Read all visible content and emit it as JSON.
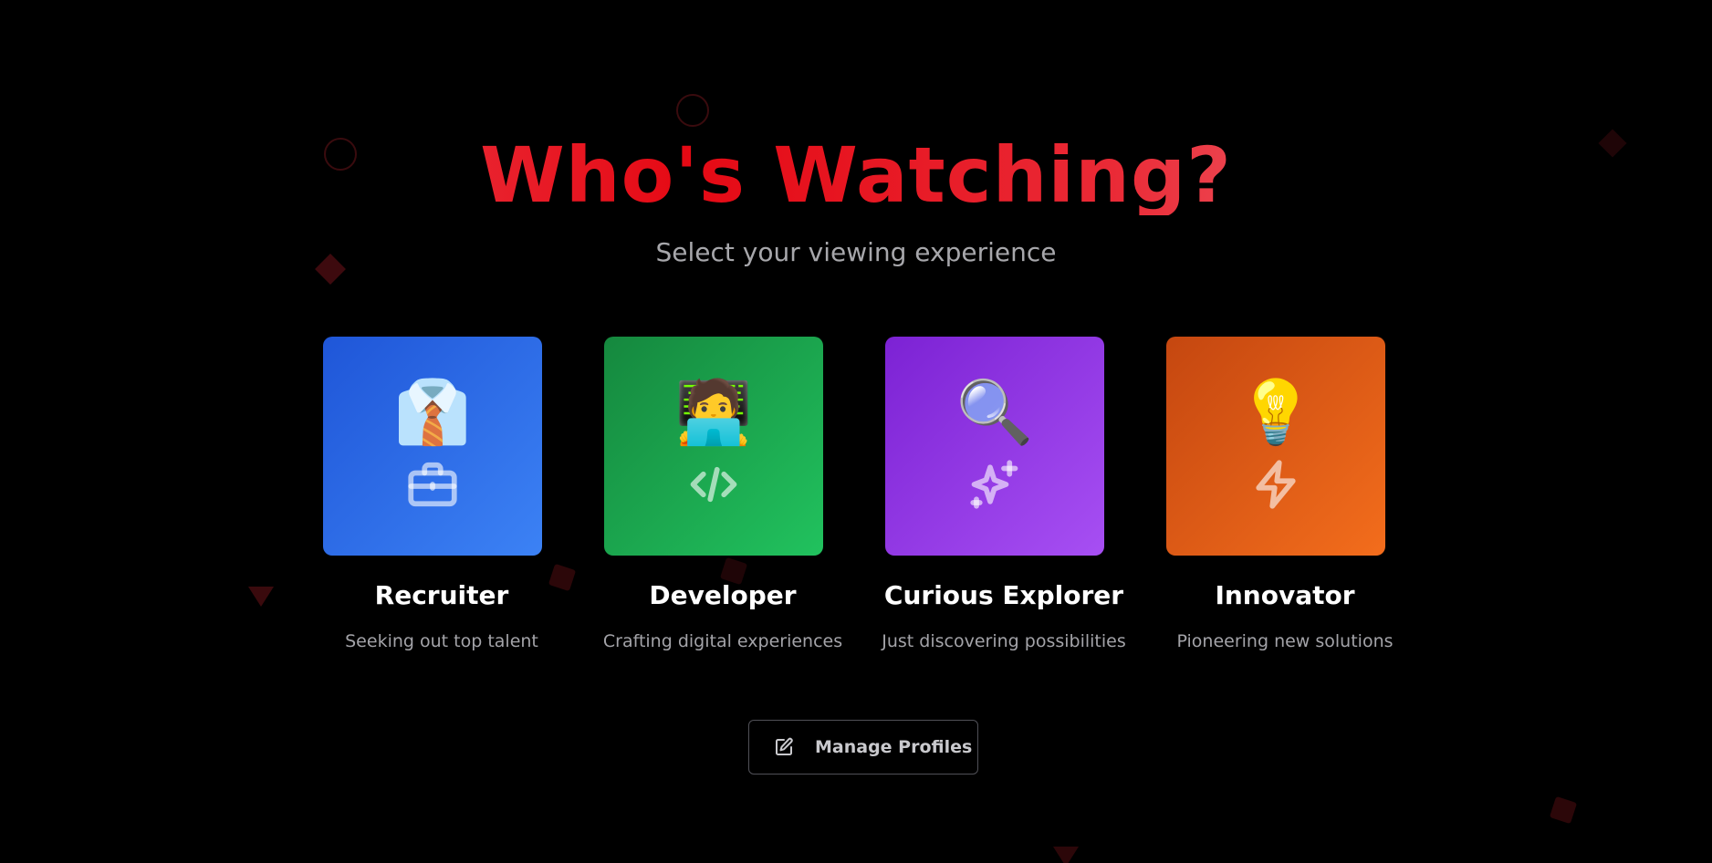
{
  "header": {
    "title": "Who's Watching?",
    "subtitle": "Select your viewing experience"
  },
  "profiles": [
    {
      "name": "Recruiter",
      "description": "Seeking out top talent",
      "emoji": "👔",
      "icon": "briefcase-icon",
      "color_from": "#1f56d8",
      "color_to": "#3c82f5"
    },
    {
      "name": "Developer",
      "description": "Crafting digital experiences",
      "emoji": "🧑‍💻",
      "icon": "code-icon",
      "color_from": "#15883e",
      "color_to": "#21c25e"
    },
    {
      "name": "Curious Explorer",
      "description": "Just discovering possibilities",
      "emoji": "🔍",
      "icon": "sparkles-icon",
      "color_from": "#7c22d4",
      "color_to": "#a74ff3"
    },
    {
      "name": "Innovator",
      "description": "Pioneering new solutions",
      "emoji": "💡",
      "icon": "zap-icon",
      "color_from": "#c54710",
      "color_to": "#f36d1c"
    }
  ],
  "actions": {
    "manage_label": "Manage Profiles",
    "manage_icon": "edit-icon"
  },
  "theme": {
    "background": "#000000",
    "accent": "#e50914"
  }
}
